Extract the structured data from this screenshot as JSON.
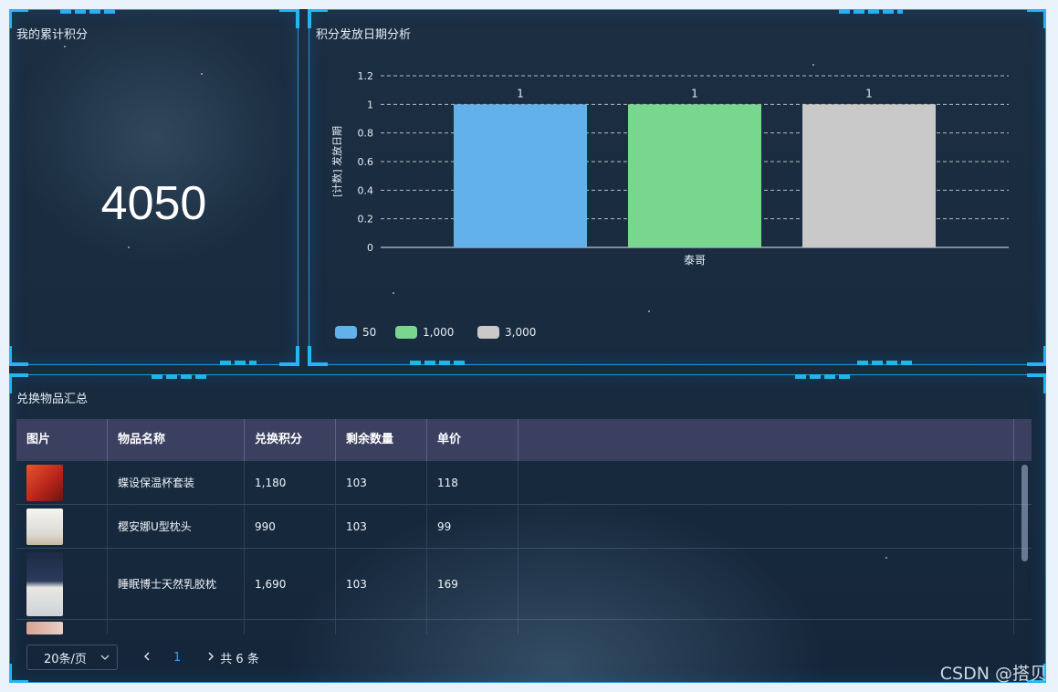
{
  "panels": {
    "points": {
      "title": "我的累计积分",
      "value": "4050"
    },
    "chart": {
      "title": "积分发放日期分析"
    },
    "exchange": {
      "title": "兑换物品汇总"
    }
  },
  "chart_data": {
    "type": "bar",
    "categories": [
      "泰哥"
    ],
    "series": [
      {
        "name": "50",
        "values": [
          1
        ],
        "color": "#63b1ea"
      },
      {
        "name": "1,000",
        "values": [
          1
        ],
        "color": "#79d68e"
      },
      {
        "name": "3,000",
        "values": [
          1
        ],
        "color": "#c9c9c9"
      }
    ],
    "ylabel": "[计数] 发放日期",
    "ylim": [
      0,
      1.2
    ],
    "yticks": [
      "0",
      "0.2",
      "0.4",
      "0.6",
      "0.8",
      "1",
      "1.2"
    ],
    "data_labels": [
      "1",
      "1",
      "1"
    ],
    "grid": true,
    "legend": "bottom-left"
  },
  "table": {
    "columns": [
      "图片",
      "物品名称",
      "兑换积分",
      "剩余数量",
      "单价"
    ],
    "rows": [
      {
        "name": "蝶设保温杯套装",
        "points": "1,180",
        "remaining": "103",
        "price": "118"
      },
      {
        "name": "樱安娜U型枕头",
        "points": "990",
        "remaining": "103",
        "price": "99"
      },
      {
        "name": "睡眠博士天然乳胶枕",
        "points": "1,690",
        "remaining": "103",
        "price": "169"
      }
    ]
  },
  "pager": {
    "page_size": "20条/页",
    "current": "1",
    "total_label": "共 6 条"
  },
  "watermark": "CSDN @搭贝",
  "icons": {
    "chevron_down": "chevron-down-icon",
    "prev": "chevron-left-icon",
    "next": "chevron-right-icon"
  }
}
